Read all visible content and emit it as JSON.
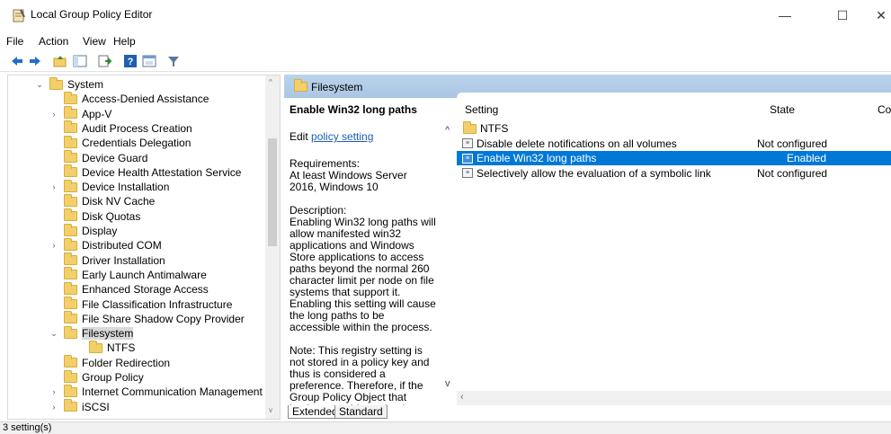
{
  "window": {
    "title": "Local Group Policy Editor",
    "minimize": "—",
    "maximize": "☐",
    "close": "✕"
  },
  "menu": [
    "File",
    "Action",
    "View",
    "Help"
  ],
  "toolbar": {
    "icons": [
      "back-arrow-icon",
      "forward-arrow-icon",
      "up-folder-icon",
      "show-hide-tree-icon",
      "export-list-icon",
      "help-icon",
      "properties-view-icon",
      "filter-icon"
    ]
  },
  "tree": {
    "items": [
      {
        "label": "System",
        "indent": 0,
        "chevron": "⌄"
      },
      {
        "label": "Access-Denied Assistance",
        "indent": 1,
        "chevron": ""
      },
      {
        "label": "App-V",
        "indent": 1,
        "chevron": "›"
      },
      {
        "label": "Audit Process Creation",
        "indent": 1,
        "chevron": ""
      },
      {
        "label": "Credentials Delegation",
        "indent": 1,
        "chevron": ""
      },
      {
        "label": "Device Guard",
        "indent": 1,
        "chevron": ""
      },
      {
        "label": "Device Health Attestation Service",
        "indent": 1,
        "chevron": ""
      },
      {
        "label": "Device Installation",
        "indent": 1,
        "chevron": "›"
      },
      {
        "label": "Disk NV Cache",
        "indent": 1,
        "chevron": ""
      },
      {
        "label": "Disk Quotas",
        "indent": 1,
        "chevron": ""
      },
      {
        "label": "Display",
        "indent": 1,
        "chevron": ""
      },
      {
        "label": "Distributed COM",
        "indent": 1,
        "chevron": "›"
      },
      {
        "label": "Driver Installation",
        "indent": 1,
        "chevron": ""
      },
      {
        "label": "Early Launch Antimalware",
        "indent": 1,
        "chevron": ""
      },
      {
        "label": "Enhanced Storage Access",
        "indent": 1,
        "chevron": ""
      },
      {
        "label": "File Classification Infrastructure",
        "indent": 1,
        "chevron": ""
      },
      {
        "label": "File Share Shadow Copy Provider",
        "indent": 1,
        "chevron": ""
      },
      {
        "label": "Filesystem",
        "indent": 1,
        "chevron": "⌄",
        "selected": true
      },
      {
        "label": "NTFS",
        "indent": 2,
        "chevron": ""
      },
      {
        "label": "Folder Redirection",
        "indent": 1,
        "chevron": ""
      },
      {
        "label": "Group Policy",
        "indent": 1,
        "chevron": ""
      },
      {
        "label": "Internet Communication Management",
        "indent": 1,
        "chevron": "›"
      },
      {
        "label": "iSCSI",
        "indent": 1,
        "chevron": "›"
      }
    ]
  },
  "header_strip": {
    "label": "Filesystem"
  },
  "description": {
    "title": "Enable Win32 long paths",
    "edit_prefix": "Edit ",
    "edit_link": "policy setting",
    "requirements_label": "Requirements:",
    "requirements": "At least Windows Server 2016, Windows 10",
    "description_label": "Description:",
    "description": "Enabling Win32 long paths will allow manifested win32 applications and Windows Store applications to access paths beyond the normal 260 character limit per node on file systems that support it.  Enabling this setting will cause the long paths to be accessible within the process.",
    "note": "Note:  This registry setting is not stored in a policy key and thus is considered a preference. Therefore, if the Group Policy Object that implements this setting is ever removed, this"
  },
  "list": {
    "columns": {
      "setting": "Setting",
      "state": "State",
      "comment": "Co"
    },
    "rows": [
      {
        "type": "folder",
        "setting": "NTFS",
        "state": ""
      },
      {
        "type": "policy",
        "setting": "Disable delete notifications on all volumes",
        "state": "Not configured"
      },
      {
        "type": "policy",
        "setting": "Enable Win32 long paths",
        "state": "Enabled",
        "selected": true
      },
      {
        "type": "policy",
        "setting": "Selectively allow the evaluation of a symbolic link",
        "state": "Not configured"
      }
    ]
  },
  "tabs": [
    "Extended",
    "Standard"
  ],
  "status": "3 setting(s)",
  "colors": {
    "selection": "#0078d7",
    "header_strip": "#bcd4ec",
    "folder": "#f3cf6b",
    "link": "#1a5fb4"
  }
}
